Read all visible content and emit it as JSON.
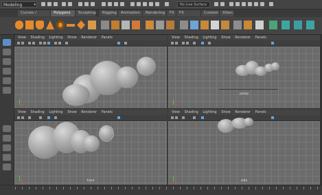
{
  "status_line": {
    "menu_set": "Modeling",
    "live_surface": "No Live Surface"
  },
  "shelf_tabs": [
    {
      "label": "Curves / Surfaces"
    },
    {
      "label": "Polygons"
    },
    {
      "label": "Sculpting"
    },
    {
      "label": "Rigging"
    },
    {
      "label": "Animation"
    },
    {
      "label": "Rendering"
    },
    {
      "label": "FX"
    },
    {
      "label": "FX Caching"
    },
    {
      "label": "Custom"
    },
    {
      "label": "XGen"
    }
  ],
  "active_shelf_tab": "Polygons",
  "panel_menu": {
    "view": "View",
    "shading": "Shading",
    "lighting": "Lighting",
    "show": "Show",
    "renderer": "Renderer",
    "panels": "Panels"
  },
  "viewports": [
    {
      "id": "persp",
      "label": ""
    },
    {
      "id": "top",
      "label": "persp"
    },
    {
      "id": "front",
      "label": "front"
    },
    {
      "id": "side",
      "label": "side"
    }
  ],
  "colors": {
    "accent": "#5ca8e6",
    "viewport_bg": "#6b6b6b",
    "ui_bg": "#3c3c3c"
  },
  "icons": {
    "select": "arrow-icon",
    "move": "move-icon",
    "rotate": "rotate-icon",
    "scale": "scale-icon"
  }
}
